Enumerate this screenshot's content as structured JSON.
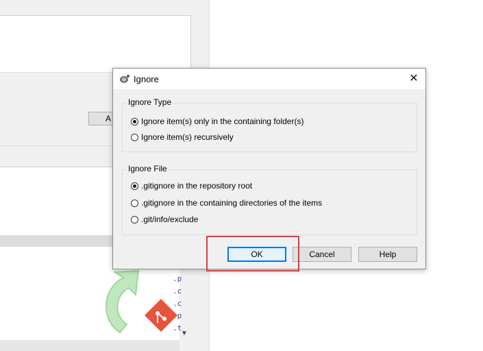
{
  "background": {
    "partial_button_label": "A",
    "list_items": [
      ".p",
      ".c",
      ".c",
      ".p",
      ".t"
    ]
  },
  "dialog": {
    "title": "Ignore",
    "close_glyph": "✕",
    "ignore_type": {
      "label": "Ignore Type",
      "options": [
        {
          "label": "Ignore item(s) only in the containing folder(s)",
          "checked": true
        },
        {
          "label": "Ignore item(s) recursively",
          "checked": false
        }
      ]
    },
    "ignore_file": {
      "label": "Ignore File",
      "options": [
        {
          "label": ".gitignore in the repository root",
          "checked": true
        },
        {
          "label": ".gitignore in the containing directories of the items",
          "checked": false
        },
        {
          "label": ".git/info/exclude",
          "checked": false
        }
      ]
    },
    "buttons": {
      "ok": "OK",
      "cancel": "Cancel",
      "help": "Help"
    }
  },
  "colors": {
    "highlight": "#e53935",
    "default_button_border": "#0078d7"
  },
  "icons": {
    "title": "tortoisegit-icon",
    "close": "close-icon",
    "scroll_down": "chevron-down-icon",
    "background_logo": "tortoisegit-logo"
  }
}
